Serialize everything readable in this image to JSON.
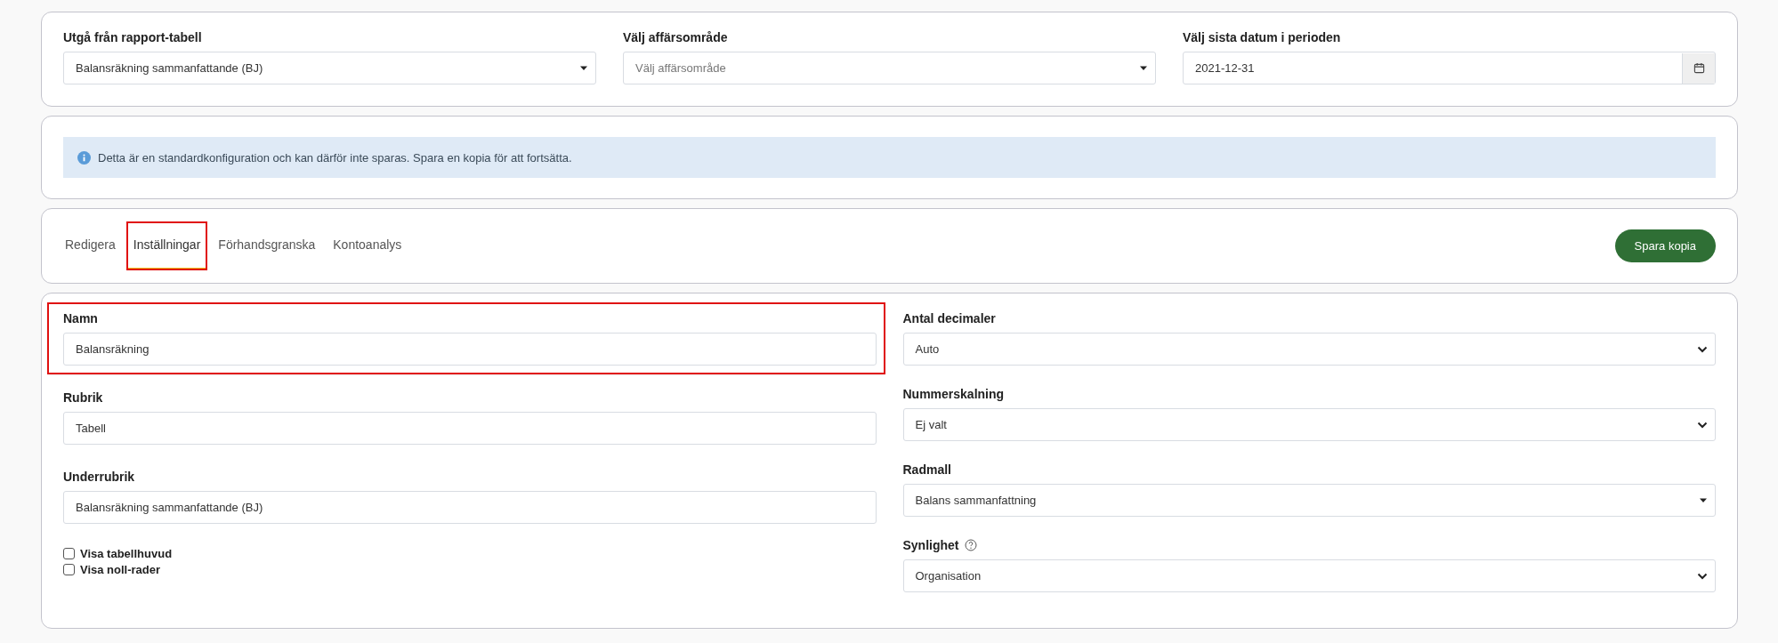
{
  "filters": [
    {
      "label": "Utgå från rapport-tabell",
      "kind": "select-caret",
      "value": "Balansräkning sammanfattande (BJ)"
    },
    {
      "label": "Välj affärsområde",
      "kind": "select-caret",
      "placeholder": "Välj affärsområde"
    },
    {
      "label": "Välj sista datum i perioden",
      "kind": "date",
      "value": "2021-12-31"
    }
  ],
  "notice": {
    "text": "Detta är en standardkonfiguration och kan därför inte sparas. Spara en kopia för att fortsätta."
  },
  "tabs": [
    {
      "label": "Redigera",
      "selected": false,
      "highlighted": false
    },
    {
      "label": "Inställningar",
      "selected": true,
      "highlighted": true
    },
    {
      "label": "Förhandsgranska",
      "selected": false,
      "highlighted": false
    },
    {
      "label": "Kontoanalys",
      "selected": false,
      "highlighted": false
    }
  ],
  "save_button": "Spara kopia",
  "left_fields": [
    {
      "label": "Namn",
      "kind": "text",
      "value": "Balansräkning",
      "highlighted": true
    },
    {
      "label": "Rubrik",
      "kind": "text",
      "value": "Tabell",
      "highlighted": false
    },
    {
      "label": "Underrubrik",
      "kind": "text",
      "value": "Balansräkning sammanfattande (BJ)",
      "highlighted": false
    }
  ],
  "checkboxes": [
    {
      "label": "Visa tabellhuvud",
      "checked": false
    },
    {
      "label": "Visa noll-rader",
      "checked": false
    }
  ],
  "right_fields": [
    {
      "label": "Antal decimaler",
      "kind": "select-chevron",
      "value": "Auto",
      "help": false
    },
    {
      "label": "Nummerskalning",
      "kind": "select-chevron",
      "value": "Ej valt",
      "help": false
    },
    {
      "label": "Radmall",
      "kind": "select-caret",
      "value": "Balans sammanfattning",
      "help": false
    },
    {
      "label": "Synlighet",
      "kind": "select-chevron",
      "value": "Organisation",
      "help": true
    }
  ]
}
